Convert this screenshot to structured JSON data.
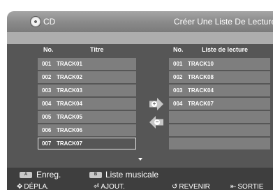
{
  "header": {
    "icon": "cd-icon",
    "source_label": "CD",
    "title": "Créer Une Liste De Lecture"
  },
  "left_list": {
    "headers": {
      "no": "No.",
      "title": "Titre"
    },
    "rows": [
      {
        "num": "001",
        "name": "TRACK01"
      },
      {
        "num": "002",
        "name": "TRACK02"
      },
      {
        "num": "003",
        "name": "TRACK03"
      },
      {
        "num": "004",
        "name": "TRACK04"
      },
      {
        "num": "005",
        "name": "TRACK05"
      },
      {
        "num": "006",
        "name": "TRACK06"
      },
      {
        "num": "007",
        "name": "TRACK07"
      }
    ],
    "selected_index": 6
  },
  "right_list": {
    "headers": {
      "no": "No.",
      "title": "Liste de lecture"
    },
    "rows": [
      {
        "num": "001",
        "name": "TRACK10"
      },
      {
        "num": "002",
        "name": "TRACK08"
      },
      {
        "num": "003",
        "name": "TRACK04"
      },
      {
        "num": "004",
        "name": "TRACK07"
      },
      {
        "num": "",
        "name": ""
      },
      {
        "num": "",
        "name": ""
      },
      {
        "num": "",
        "name": ""
      }
    ]
  },
  "controls": {
    "add_symbol": "+",
    "remove_symbol": "−"
  },
  "buttons": {
    "a_key": "A",
    "a_label": "Enreg.",
    "b_key": "B",
    "b_label": "Liste musicale"
  },
  "nav": {
    "move": "DÉPLA.",
    "add": "AJOUT.",
    "back": "REVENIR",
    "exit": "SORTIE"
  }
}
